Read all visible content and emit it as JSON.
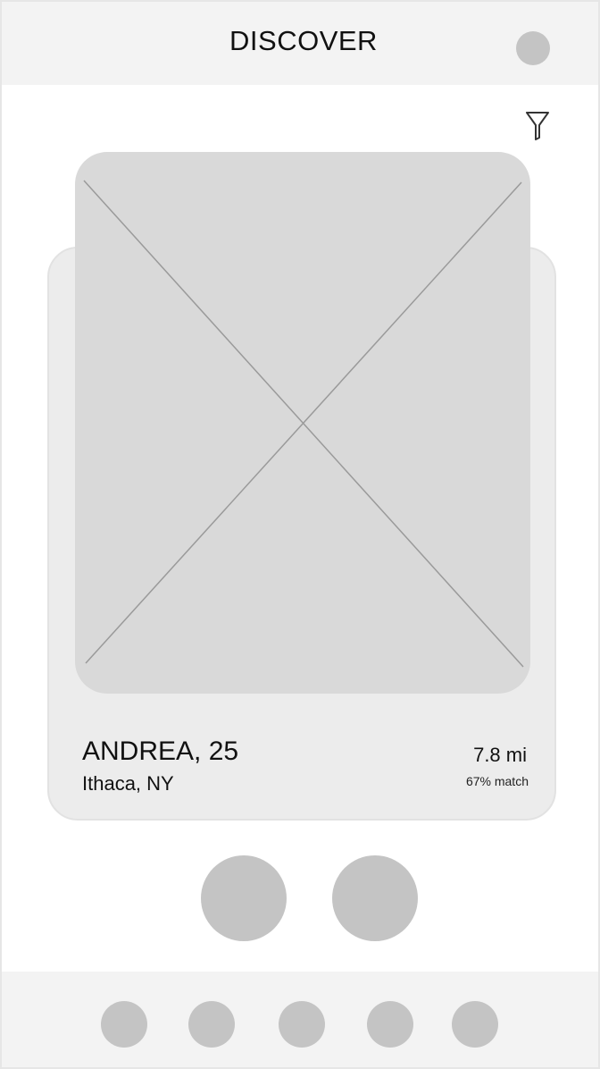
{
  "header": {
    "title": "DISCOVER",
    "avatar_icon": "profile-avatar-icon"
  },
  "filter": {
    "icon": "funnel-filter-icon"
  },
  "profile": {
    "photo_placeholder_icon": "image-placeholder-icon",
    "name_age": "ANDREA, 25",
    "location": "Ithaca, NY",
    "distance": "7.8 mi",
    "match": "67% match"
  },
  "actions": [
    {
      "icon": "action-circle-icon"
    },
    {
      "icon": "action-circle-icon"
    }
  ],
  "bottom_nav": {
    "items": [
      {
        "icon": "nav-circle-icon"
      },
      {
        "icon": "nav-circle-icon"
      },
      {
        "icon": "nav-circle-icon"
      },
      {
        "icon": "nav-circle-icon"
      },
      {
        "icon": "nav-circle-icon"
      }
    ]
  },
  "colors": {
    "header_bg": "#f3f3f3",
    "card_bg": "#ececec",
    "photo_bg": "#d9d9d9",
    "placeholder_circle": "#c4c4c4"
  }
}
